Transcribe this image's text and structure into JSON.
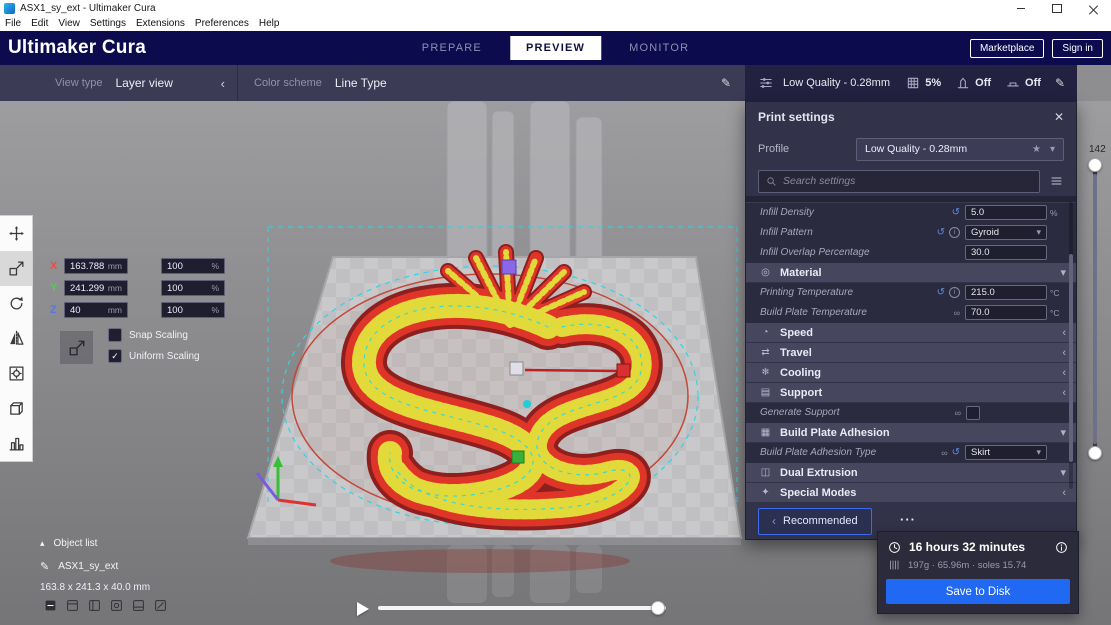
{
  "window": {
    "title": "ASX1_sy_ext - Ultimaker Cura",
    "menu": [
      "File",
      "Edit",
      "View",
      "Settings",
      "Extensions",
      "Preferences",
      "Help"
    ]
  },
  "header": {
    "logo": "Ultimaker Cura",
    "tabs": [
      {
        "label": "PREPARE",
        "active": false
      },
      {
        "label": "PREVIEW",
        "active": true
      },
      {
        "label": "MONITOR",
        "active": false
      }
    ],
    "marketplace_label": "Marketplace",
    "signin_label": "Sign in"
  },
  "viewbar": {
    "view_type_label": "View type",
    "view_type_value": "Layer view",
    "color_scheme_label": "Color scheme",
    "color_scheme_value": "Line Type"
  },
  "summary": {
    "profile": "Low Quality - 0.28mm",
    "infill_value": "5%",
    "support_value": "Off",
    "adhesion_value": "Off"
  },
  "print_settings": {
    "title": "Print settings",
    "profile_label": "Profile",
    "profile_value": "Low Quality - 0.28mm",
    "search_placeholder": "Search settings",
    "recommended_label": "Recommended",
    "rows": [
      {
        "type": "setting",
        "label": "Infill Density",
        "value": "5.0",
        "unit": "%",
        "icons": [
          "revert"
        ],
        "control": "input"
      },
      {
        "type": "setting",
        "label": "Infill Pattern",
        "value": "Gyroid",
        "unit": "",
        "icons": [
          "revert",
          "info"
        ],
        "control": "select"
      },
      {
        "type": "setting",
        "label": "Infill Overlap Percentage",
        "value": "30.0",
        "unit": "",
        "icons": [],
        "control": "input"
      },
      {
        "type": "category",
        "label": "Material",
        "icon": "material-icon",
        "chevron": "down"
      },
      {
        "type": "setting",
        "label": "Printing Temperature",
        "value": "215.0",
        "unit": "°C",
        "icons": [
          "revert",
          "info"
        ],
        "control": "input"
      },
      {
        "type": "setting",
        "label": "Build Plate Temperature",
        "value": "70.0",
        "unit": "°C",
        "icons": [
          "link"
        ],
        "control": "input"
      },
      {
        "type": "category",
        "label": "Speed",
        "icon": "speed-icon",
        "chevron": "left"
      },
      {
        "type": "category",
        "label": "Travel",
        "icon": "travel-icon",
        "chevron": "left"
      },
      {
        "type": "category",
        "label": "Cooling",
        "icon": "cooling-icon",
        "chevron": "left"
      },
      {
        "type": "category",
        "label": "Support",
        "icon": "support-icon",
        "chevron": "left"
      },
      {
        "type": "setting",
        "label": "Generate Support",
        "value": "",
        "unit": "",
        "icons": [
          "link"
        ],
        "control": "checkbox",
        "checked": false
      },
      {
        "type": "category",
        "label": "Build Plate Adhesion",
        "icon": "adhesion-icon",
        "chevron": "down"
      },
      {
        "type": "setting",
        "label": "Build Plate Adhesion Type",
        "value": "Skirt",
        "unit": "",
        "icons": [
          "link",
          "revert"
        ],
        "control": "select"
      },
      {
        "type": "category",
        "label": "Dual Extrusion",
        "icon": "dual-extrusion-icon",
        "chevron": "down"
      },
      {
        "type": "category",
        "label": "Special Modes",
        "icon": "special-modes-icon",
        "chevron": "left"
      }
    ]
  },
  "tools": [
    {
      "name": "move-tool",
      "active": false
    },
    {
      "name": "scale-tool",
      "active": true
    },
    {
      "name": "rotate-tool",
      "active": false
    },
    {
      "name": "mirror-tool",
      "active": false
    },
    {
      "name": "per-model-settings-tool",
      "active": false
    },
    {
      "name": "support-blocker-tool",
      "active": false
    },
    {
      "name": "custom-tool",
      "active": false
    }
  ],
  "scale_panel": {
    "axes": [
      {
        "axis": "X",
        "size": "163.788",
        "size_unit": "mm",
        "pct": "100",
        "pct_unit": "%",
        "color": "#e05050"
      },
      {
        "axis": "Y",
        "size": "241.299",
        "size_unit": "mm",
        "pct": "100",
        "pct_unit": "%",
        "color": "#58c858"
      },
      {
        "axis": "Z",
        "size": "40",
        "size_unit": "mm",
        "pct": "100",
        "pct_unit": "%",
        "color": "#5878e0"
      }
    ],
    "snap_label": "Snap Scaling",
    "snap_checked": false,
    "uniform_label": "Uniform Scaling",
    "uniform_checked": true
  },
  "object_panel": {
    "list_label": "Object list",
    "name": "ASX1_sy_ext",
    "dimensions": "163.8 x 241.3 x 40.0 mm"
  },
  "layer_slider": {
    "value": "142"
  },
  "job": {
    "time": "16 hours 32 minutes",
    "material": "197g · 65.96m · soles 15.74",
    "save_label": "Save to Disk"
  },
  "colors": {
    "header_navy": "#0b0b4e",
    "accent_blue": "#2168f3",
    "model_red": "#df3528",
    "infill_yellow": "#e2da3a",
    "outline_cyan": "#25dbe8"
  }
}
